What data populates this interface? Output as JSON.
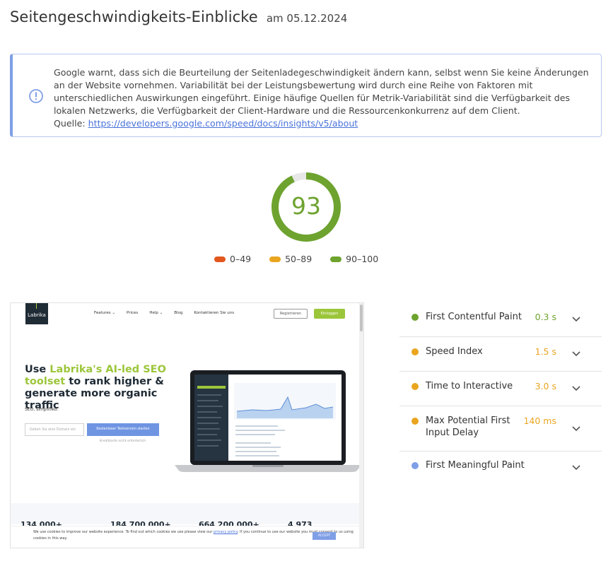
{
  "header": {
    "title": "Seitengeschwindigkeits-Einblicke",
    "date": "am 05.12.2024"
  },
  "notice": {
    "icon": "info-icon",
    "text": "Google warnt, dass sich die Beurteilung der Seitenladegeschwindigkeit ändern kann, selbst wenn Sie keine Änderungen an der Website vornehmen. Variabilität bei der Leistungsbewertung wird durch eine Reihe von Faktoren mit unterschiedlichen Auswirkungen eingeführt. Einige häufige Quellen für Metrik-Variabilität sind die Verfügbarkeit des lokalen Netzwerks, die Verfügbarkeit der Client-Hardware und die Ressourcenkonkurrenz auf dem Client.",
    "source_label": "Quelle:",
    "source_link": "https://developers.google.com/speed/docs/insights/v5/about"
  },
  "score": {
    "value": "93",
    "fraction": 0.93,
    "color": "#6da32e"
  },
  "legend": [
    {
      "label": "0–49",
      "color": "#e2571e"
    },
    {
      "label": "50–89",
      "color": "#eaa520"
    },
    {
      "label": "90–100",
      "color": "#6da32e"
    }
  ],
  "screenshot": {
    "logo": "Labrika",
    "nav": [
      "Features ⌄",
      "Prices",
      "Help ⌄",
      "Blog",
      "Kontaktieren Sie uns"
    ],
    "register": "Registrieren",
    "login": "Einloggen",
    "headline_pre": "Use ",
    "headline_green": "Labrika's AI-led SEO toolset",
    "headline_post": " to rank higher & generate more organic traffic",
    "sub": "SEO, simplified.",
    "input_placeholder": "Geben Sie eine Domain ein",
    "cta": "Kostenloser Testversion starten",
    "no_cc": "Kreditkarte nicht erforderlich",
    "stats": [
      "134 000+",
      "184 700 000+",
      "664 200 000+",
      "4 973"
    ],
    "cookie_text_1": "We use cookies to improve our website experience. To find out which cookies we use please view our",
    "cookie_link": "privacy policy",
    "cookie_text_2": ". If you continue to use our website you must consent to us using cookies in this way.",
    "cookie_accept": "ACCEPT"
  },
  "metrics": [
    {
      "name": "First Contentful Paint",
      "value": "0.3 s",
      "color": "#6da32e"
    },
    {
      "name": "Speed Index",
      "value": "1.5 s",
      "color": "#eaa520"
    },
    {
      "name": "Time to Interactive",
      "value": "3.0 s",
      "color": "#eaa520"
    },
    {
      "name": "Max Potential First Input Delay",
      "value": "140 ms",
      "color": "#eaa520"
    },
    {
      "name": "First Meaningful Paint",
      "value": "",
      "color": "#7f9fe6"
    }
  ]
}
